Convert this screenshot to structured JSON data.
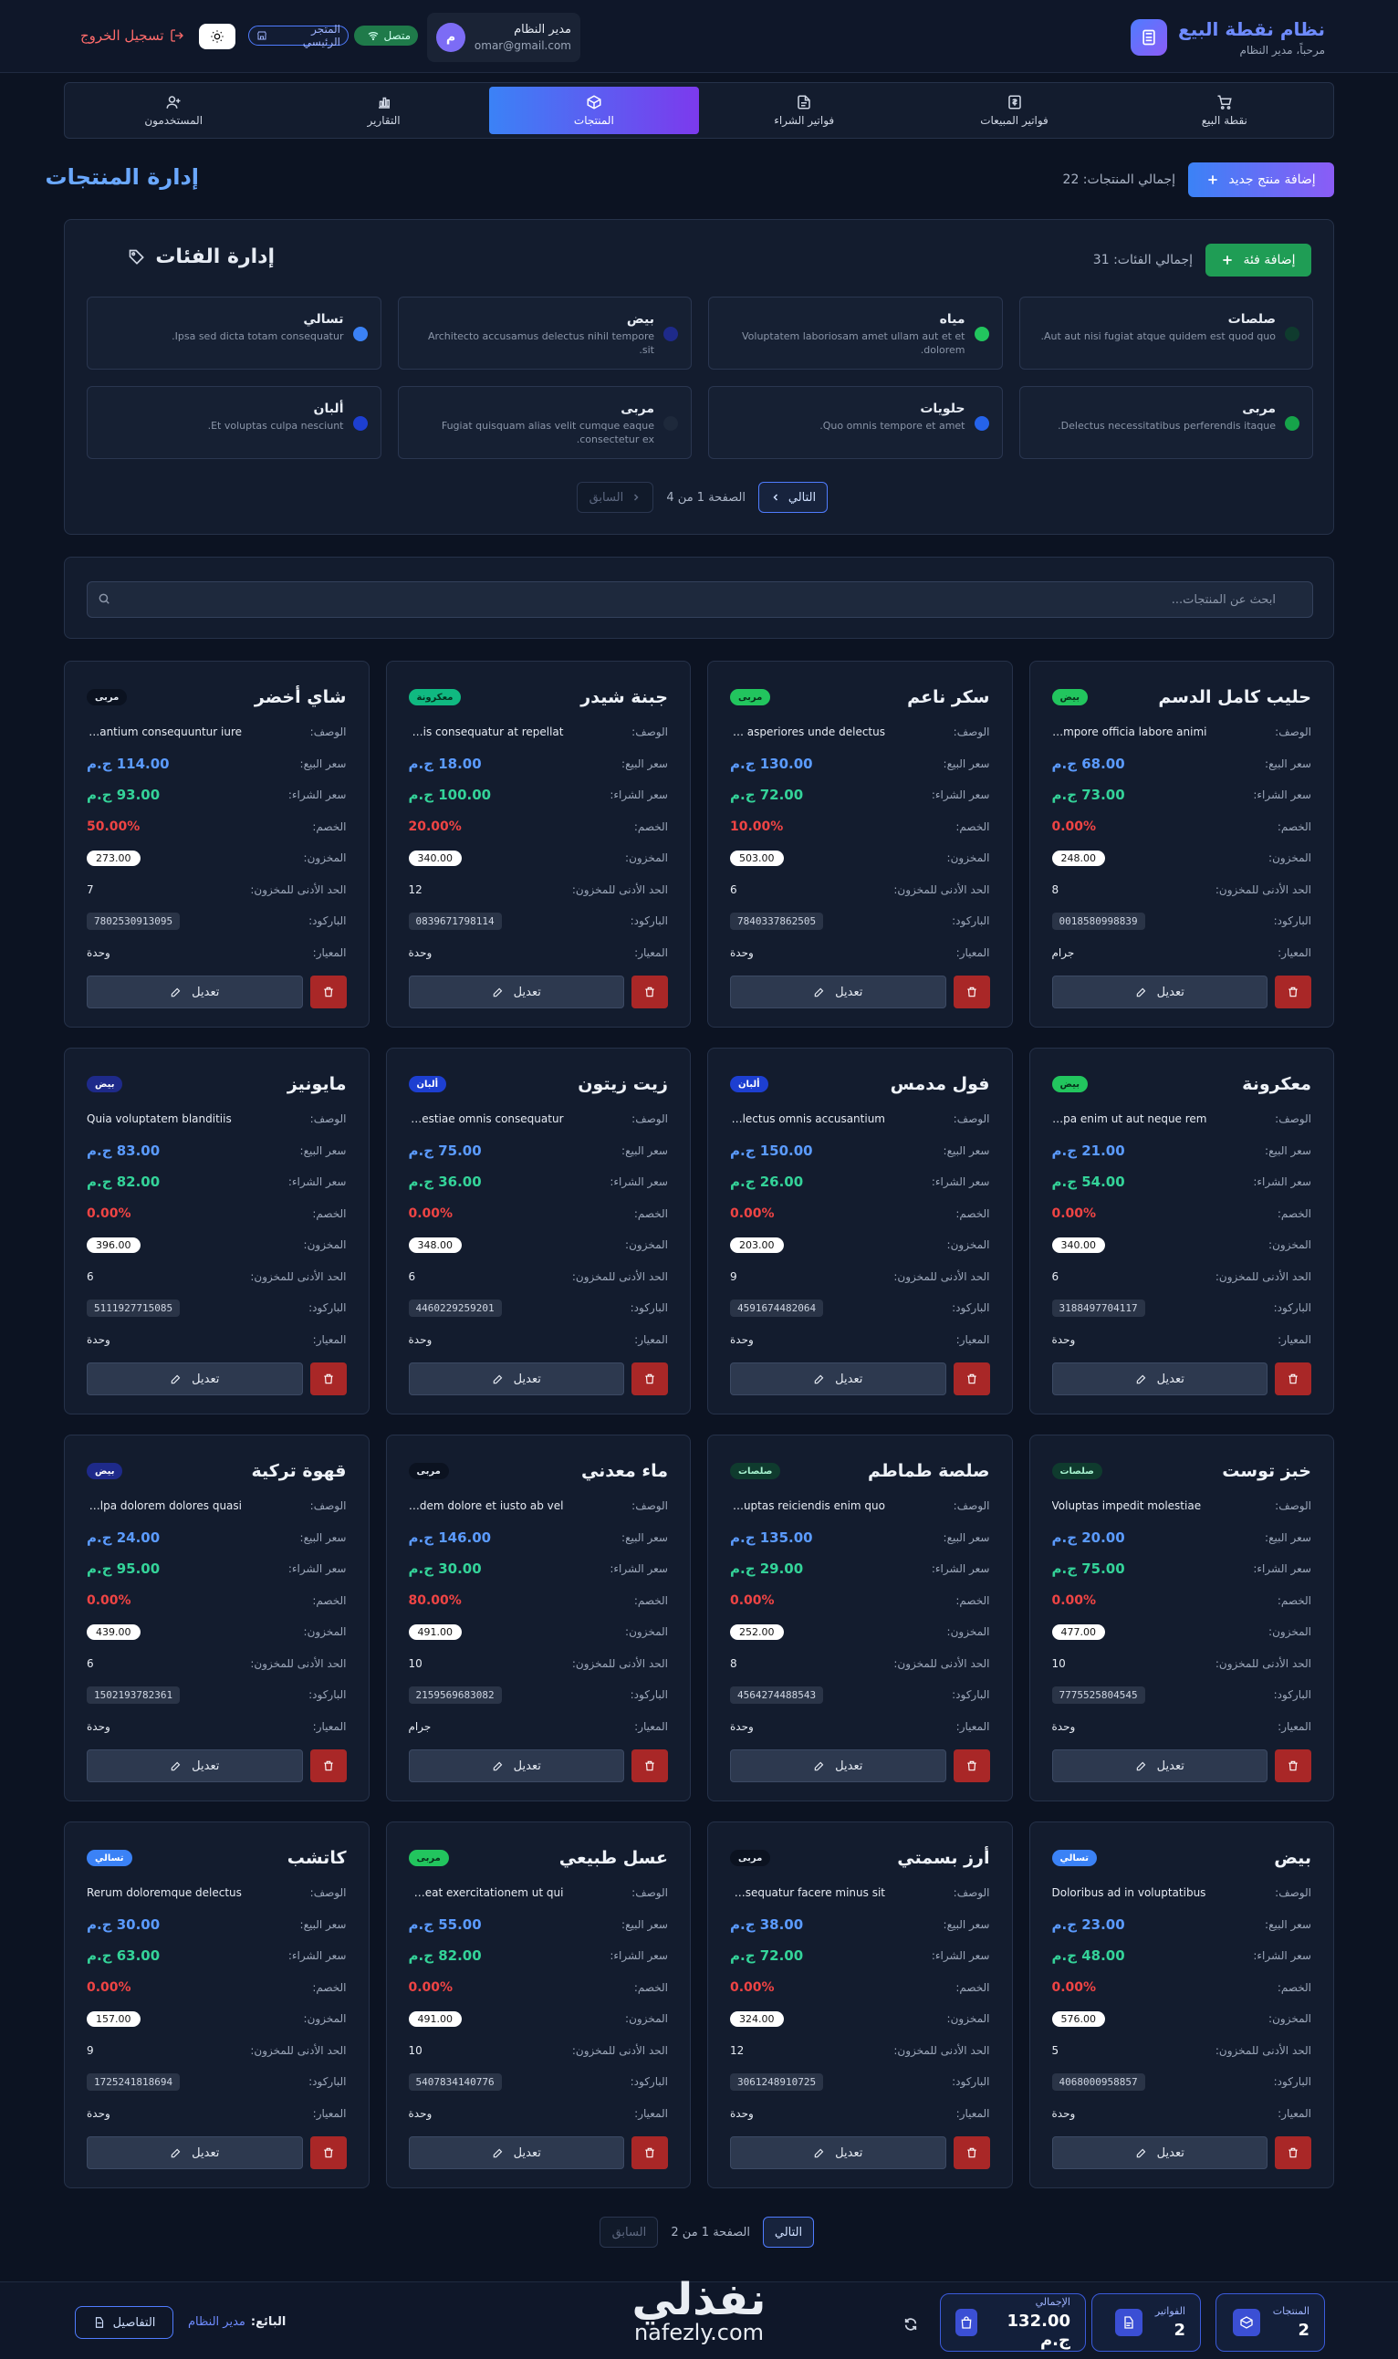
{
  "header": {
    "title": "نظام نقطة البيع",
    "subtitle": "مرحباً، مدير النظام",
    "user_name": "مدير النظام",
    "user_email": "omar@gmail.com",
    "avatar_letter": "م",
    "status": "متصل",
    "store": "المتجر الرئيسي",
    "logout": "تسجيل الخروج"
  },
  "nav": [
    {
      "label": "نقطة البيع",
      "icon": "cart-icon"
    },
    {
      "label": "فواتير المبيعات",
      "icon": "receipt-icon"
    },
    {
      "label": "فواتير الشراء",
      "icon": "file-icon"
    },
    {
      "label": "المنتجات",
      "icon": "box-icon",
      "active": true
    },
    {
      "label": "التقارير",
      "icon": "chart-icon"
    },
    {
      "label": "المستخدمون",
      "icon": "users-icon"
    }
  ],
  "page": {
    "title": "إدارة المنتجات",
    "add_product": "إضافة منتج جديد",
    "total_products": "إجمالي المنتجات: 22"
  },
  "categories": {
    "title": "إدارة الفئات",
    "add": "إضافة فئة",
    "total": "إجمالي الفئات: 31",
    "items": [
      {
        "name": "صلصات",
        "desc": "Aut aut nisi fugiat atque quidem est quod quo.",
        "color": "#0f3b2e"
      },
      {
        "name": "مياه",
        "desc": "Voluptatem laboriosam amet ullam aut et et dolorem.",
        "color": "#22c55e"
      },
      {
        "name": "بيض",
        "desc": "Architecto accusamus delectus nihil tempore sit.",
        "color": "#1e2a8a"
      },
      {
        "name": "تسالي",
        "desc": "Ipsa sed dicta totam consequatur.",
        "color": "#3b82f6"
      },
      {
        "name": "مربى",
        "desc": "Delectus necessitatibus perferendis itaque.",
        "color": "#16a34a"
      },
      {
        "name": "حلويات",
        "desc": "Quo omnis tempore et amet.",
        "color": "#2563eb"
      },
      {
        "name": "مربى",
        "desc": "Fugiat quisquam alias velit cumque eaque consectetur ex.",
        "color": "#1e293b"
      },
      {
        "name": "ألبان",
        "desc": "Et voluptas culpa nesciunt.",
        "color": "#1d3fd1"
      }
    ],
    "pager": {
      "next": "التالي",
      "prev": "السابق",
      "info": "الصفحة 1 من 4"
    }
  },
  "search": {
    "placeholder": "ابحث عن المنتجات..."
  },
  "labels": {
    "desc": "الوصف:",
    "sell": "سعر البيع:",
    "buy": "سعر الشراء:",
    "discount": "الخصم:",
    "stock": "المخزون:",
    "min_stock": "الحد الأدنى للمخزون:",
    "barcode": "الباركود:",
    "unit": "المعيار:",
    "edit": "تعديل"
  },
  "products": [
    {
      "name": "حليب كامل الدسم",
      "badge": "بيض",
      "badge_bg": "#22c55e",
      "badge_fg": "#06301a",
      "desc": "Tempore officia labore animi",
      "sell": "68.00 ج.م",
      "buy": "73.00 ج.م",
      "discount": "0.00%",
      "stock": "248.00",
      "min": "8",
      "barcode": "0018580998839",
      "unit": "جرام"
    },
    {
      "name": "سكر ناعم",
      "badge": "مربى",
      "badge_bg": "#22c55e",
      "badge_fg": "#06301a",
      "desc": "Eum asperiores unde delectus",
      "sell": "130.00 ج.م",
      "buy": "72.00 ج.م",
      "discount": "10.00%",
      "stock": "503.00",
      "min": "6",
      "barcode": "7840337862505",
      "unit": "وحدة"
    },
    {
      "name": "جبنة شيدر",
      "badge": "معكرونة",
      "badge_bg": "#10b981",
      "badge_fg": "#04301f",
      "desc": "Nobis consequatur at repellat",
      "sell": "18.00 ج.م",
      "buy": "100.00 ج.م",
      "discount": "20.00%",
      "stock": "340.00",
      "min": "12",
      "barcode": "0839671798114",
      "unit": "وحدة"
    },
    {
      "name": "شاي أخضر",
      "badge": "مربى",
      "badge_bg": "#0b1220",
      "badge_fg": "#e6ebf3",
      "desc": "Laudantium consequuntur iure",
      "sell": "114.00 ج.م",
      "buy": "93.00 ج.م",
      "discount": "50.00%",
      "stock": "273.00",
      "min": "7",
      "barcode": "7802530913095",
      "unit": "وحدة"
    },
    {
      "name": "معكرونة",
      "badge": "بيض",
      "badge_bg": "#22c55e",
      "badge_fg": "#06301a",
      "desc": "Culpa enim ut aut neque rem",
      "sell": "21.00 ج.م",
      "buy": "54.00 ج.م",
      "discount": "0.00%",
      "stock": "340.00",
      "min": "6",
      "barcode": "3188497704117",
      "unit": "وحدة"
    },
    {
      "name": "فول مدمس",
      "badge": "ألبان",
      "badge_bg": "#1d3fd1",
      "badge_fg": "#ffffff",
      "desc": "Delectus omnis accusantium",
      "sell": "150.00 ج.م",
      "buy": "26.00 ج.م",
      "discount": "0.00%",
      "stock": "203.00",
      "min": "9",
      "barcode": "4591674482064",
      "unit": "وحدة"
    },
    {
      "name": "زيت زيتون",
      "badge": "ألبان",
      "badge_bg": "#1d3fd1",
      "badge_fg": "#ffffff",
      "desc": "Molestiae omnis consequatur",
      "sell": "75.00 ج.م",
      "buy": "36.00 ج.م",
      "discount": "0.00%",
      "stock": "348.00",
      "min": "6",
      "barcode": "4460229259201",
      "unit": "وحدة"
    },
    {
      "name": "مايونيز",
      "badge": "بيض",
      "badge_bg": "#1e2a8a",
      "badge_fg": "#ffffff",
      "desc": "Quia voluptatem blanditiis",
      "sell": "83.00 ج.م",
      "buy": "82.00 ج.م",
      "discount": "0.00%",
      "stock": "396.00",
      "min": "6",
      "barcode": "5111927715085",
      "unit": "وحدة"
    },
    {
      "name": "خبز توست",
      "badge": "صلصات",
      "badge_bg": "#0f3b2e",
      "badge_fg": "#a7f3d0",
      "desc": "Voluptas impedit molestiae",
      "sell": "20.00 ج.م",
      "buy": "75.00 ج.م",
      "discount": "0.00%",
      "stock": "477.00",
      "min": "10",
      "barcode": "7775525804545",
      "unit": "وحدة"
    },
    {
      "name": "صلصة طماطم",
      "badge": "صلصات",
      "badge_bg": "#0f3b2e",
      "badge_fg": "#a7f3d0",
      "desc": "Voluptas reiciendis enim quo",
      "sell": "135.00 ج.م",
      "buy": "29.00 ج.م",
      "discount": "0.00%",
      "stock": "252.00",
      "min": "8",
      "barcode": "4564274488543",
      "unit": "وحدة"
    },
    {
      "name": "ماء معدني",
      "badge": "مربى",
      "badge_bg": "#0b1220",
      "badge_fg": "#e6ebf3",
      "desc": "Quidem dolore et iusto ab vel",
      "sell": "146.00 ج.م",
      "buy": "30.00 ج.م",
      "discount": "80.00%",
      "stock": "491.00",
      "min": "10",
      "barcode": "2159569683082",
      "unit": "جرام"
    },
    {
      "name": "قهوة تركية",
      "badge": "بيض",
      "badge_bg": "#1e2a8a",
      "badge_fg": "#ffffff",
      "desc": "Culpa dolorem dolores quasi",
      "sell": "24.00 ج.م",
      "buy": "95.00 ج.م",
      "discount": "0.00%",
      "stock": "439.00",
      "min": "6",
      "barcode": "1502193782361",
      "unit": "وحدة"
    },
    {
      "name": "بيض",
      "badge": "تسالي",
      "badge_bg": "#3b82f6",
      "badge_fg": "#ffffff",
      "desc": "Doloribus ad in voluptatibus",
      "sell": "23.00 ج.م",
      "buy": "48.00 ج.م",
      "discount": "0.00%",
      "stock": "576.00",
      "min": "5",
      "barcode": "4068000958857",
      "unit": "وحدة"
    },
    {
      "name": "أرز بسمتي",
      "badge": "مربى",
      "badge_bg": "#0b1220",
      "badge_fg": "#e6ebf3",
      "desc": "Consequatur facere minus sit",
      "sell": "38.00 ج.م",
      "buy": "72.00 ج.م",
      "discount": "0.00%",
      "stock": "324.00",
      "min": "12",
      "barcode": "3061248910725",
      "unit": "وحدة"
    },
    {
      "name": "عسل طبيعي",
      "badge": "مربى",
      "badge_bg": "#22c55e",
      "badge_fg": "#06301a",
      "desc": "Placeat exercitationem ut qui",
      "sell": "55.00 ج.م",
      "buy": "82.00 ج.م",
      "discount": "0.00%",
      "stock": "491.00",
      "min": "10",
      "barcode": "5407834140776",
      "unit": "وحدة"
    },
    {
      "name": "كاتشب",
      "badge": "تسالي",
      "badge_bg": "#3b82f6",
      "badge_fg": "#ffffff",
      "desc": "Rerum doloremque delectus",
      "sell": "30.00 ج.م",
      "buy": "63.00 ج.م",
      "discount": "0.00%",
      "stock": "157.00",
      "min": "9",
      "barcode": "1725241818694",
      "unit": "وحدة"
    }
  ],
  "product_pager": {
    "next": "التالي",
    "prev": "السابق",
    "info": "الصفحة 1 من 2"
  },
  "footer": {
    "stats": [
      {
        "label": "المنتجات",
        "value": "2"
      },
      {
        "label": "الفواتير",
        "value": "2"
      },
      {
        "label": "الإجمالي",
        "value": "132.00 ج.م"
      }
    ],
    "cashier_label": "البائع:",
    "cashier_name": "مدير النظام",
    "details": "التفاصيل"
  },
  "watermark": {
    "ar": "نفذلي",
    "en": "nafezly.com"
  }
}
